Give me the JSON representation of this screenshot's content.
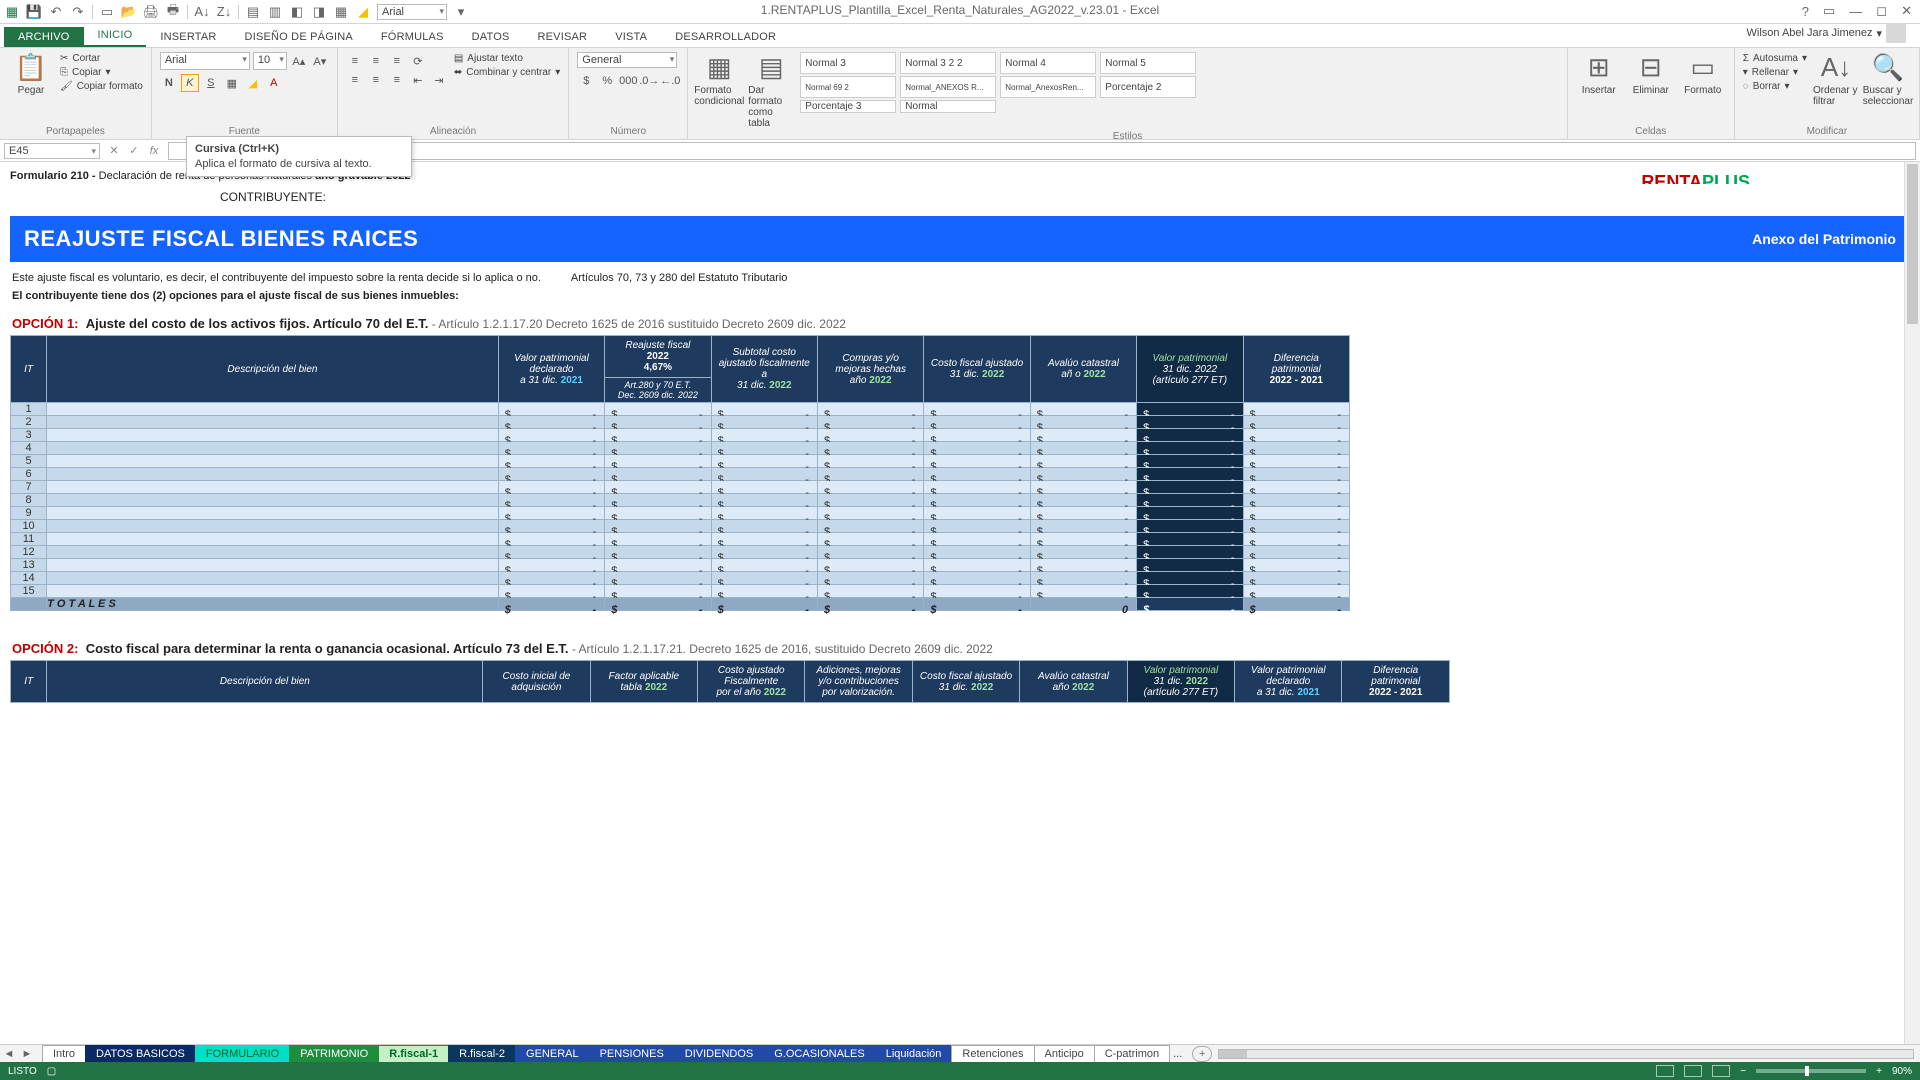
{
  "app": {
    "title": "1.RENTAPLUS_Plantilla_Excel_Renta_Naturales_AG2022_v.23.01 - Excel",
    "user": "Wilson Abel Jara Jimenez"
  },
  "qat_font": "Arial",
  "tabs": {
    "file": "ARCHIVO",
    "items": [
      "INICIO",
      "INSERTAR",
      "DISEÑO DE PÁGINA",
      "FÓRMULAS",
      "DATOS",
      "REVISAR",
      "VISTA",
      "DESARROLLADOR"
    ],
    "active": 0
  },
  "ribbon": {
    "clipboard": {
      "label": "Portapapeles",
      "paste": "Pegar",
      "cut": "Cortar",
      "copy": "Copiar",
      "painter": "Copiar formato"
    },
    "font": {
      "label": "Fuente",
      "name": "Arial",
      "size": "10"
    },
    "align": {
      "label": "Alineación",
      "wrap": "Ajustar texto",
      "merge": "Combinar y centrar"
    },
    "number": {
      "label": "Número",
      "format": "General"
    },
    "styles": {
      "label": "Estilos",
      "cond": "Formato condicional",
      "table": "Dar formato como tabla",
      "cells": [
        "Normal 3",
        "Normal 3 2 2",
        "Normal 4",
        "Normal 5",
        "Normal 69 2",
        "Normal_ANEXOS R...",
        "Normal_AnexosRen...",
        "Porcentaje 2",
        "Porcentaje 3",
        "Normal"
      ]
    },
    "cells": {
      "label": "Celdas",
      "insert": "Insertar",
      "delete": "Eliminar",
      "format": "Formato"
    },
    "edit": {
      "label": "Modificar",
      "sum": "Autosuma",
      "fill": "Rellenar",
      "clear": "Borrar",
      "sort": "Ordenar y filtrar",
      "find": "Buscar y seleccionar"
    }
  },
  "namebox": "E45",
  "tooltip": {
    "title": "Cursiva (Ctrl+K)",
    "body": "Aplica el formato de cursiva al texto."
  },
  "doc": {
    "form_pre": "Formulario 210 - ",
    "form_mid": "Declaración de renta de personas naturales ",
    "form_bold": "año gravable 2022",
    "contrib": "CONTRIBUYENTE:",
    "brand_a": "RENTA",
    "brand_b": "PLUS",
    "banner_title": "REAJUSTE FISCAL BIENES RAICES",
    "banner_right": "Anexo del Patrimonio",
    "intro_a": "Este ajuste fiscal es voluntario, es decir, el contribuyente del impuesto sobre la renta decide si lo aplica o no.",
    "intro_b": "Artículos 70, 73 y 280 del Estatuto Tributario",
    "intro2": "El contribuyente tiene dos (2) opciones para el ajuste fiscal de sus bienes inmuebles:",
    "op1": {
      "tag": "OPCIÓN 1:",
      "title": "Ajuste del costo de los activos fijos. Artículo 70 del E.T.",
      "ref": " - Artículo 1.2.1.17.20 Decreto 1625 de 2016 sustituido Decreto 2609 dic. 2022"
    },
    "op2": {
      "tag": "OPCIÓN 2:",
      "title": "Costo fiscal para determinar la renta o ganancia ocasional. Artículo 73  del E.T.",
      "ref": " - Artículo 1.2.1.17.21. Decreto 1625 de 2016, sustituido Decreto 2609 dic. 2022"
    }
  },
  "t1": {
    "h": {
      "it": "IT",
      "desc": "Descripción del bien",
      "c1a": "Valor patrimonial declarado",
      "c1b": "a 31 dic. ",
      "c1y": "2021",
      "rf_top": "Reajuste fiscal",
      "rf_yr": "2022",
      "rf_pct": "4,67%",
      "rf_sub1": "Art.280 y 70 E.T.",
      "rf_sub2": "Dec. 2609 dic. 2022",
      "c3a": "Subtotal costo ajustado fiscalmente a",
      "c3b": "31 dic. ",
      "c3y": "2022",
      "c4a": "Compras y/o mejoras hechas",
      "c4b": "año ",
      "c4y": "2022",
      "c5a": "Costo fiscal ajustado",
      "c5b": "31 dic. ",
      "c5y": "2022",
      "c6a": "Avalúo catastral",
      "c6b": "añ o ",
      "c6y": "2022",
      "c7a": "Valor patrimonial",
      "c7b": "31 dic. 2022",
      "c7c": "(artículo 277 ET)",
      "c8a": "Diferencia patrimonial",
      "c8b": "2022 - 2021"
    },
    "rows": [
      1,
      2,
      3,
      4,
      5,
      6,
      7,
      8,
      9,
      10,
      11,
      12,
      13,
      14,
      15
    ],
    "total": "T O T A L E S",
    "zero": "0"
  },
  "t2": {
    "h": {
      "it": "IT",
      "desc": "Descripción del bien",
      "c1": "Costo inicial de adquisición",
      "c2a": "Factor aplicable",
      "c2b": "tabla ",
      "c2y": "2022",
      "c3a": "Costo ajustado Fiscalmente",
      "c3b": "por el año ",
      "c3y": "2022",
      "c4a": "Adiciones, mejoras y/o contribuciones por valorización.",
      "c5a": "Costo fiscal ajustado",
      "c5b": "31 dic. ",
      "c5y": "2022",
      "c6a": "Avalúo catastral",
      "c6b": "año ",
      "c6y": "2022",
      "c7a": "Valor patrimonial",
      "c7b": "31 dic. ",
      "c7y": "2022",
      "c7c": "(artículo 277 ET)",
      "c8a": "Valor patrimonial declarado",
      "c8b": "a 31 dic. ",
      "c8y": "2021",
      "c9a": "Diferencia patrimonial",
      "c9b": "2022 - 2021"
    }
  },
  "sheets": [
    "Intro",
    "DATOS BASICOS",
    "FORMULARIO",
    "PATRIMONIO",
    "R.fiscal-1",
    "R.fiscal-2",
    "GENERAL",
    "PENSIONES",
    "DIVIDENDOS",
    "G.OCASIONALES",
    "Liquidación",
    "Retenciones",
    "Anticipo",
    "C-patrimon"
  ],
  "status": {
    "ready": "LISTO",
    "zoom": "90%"
  }
}
